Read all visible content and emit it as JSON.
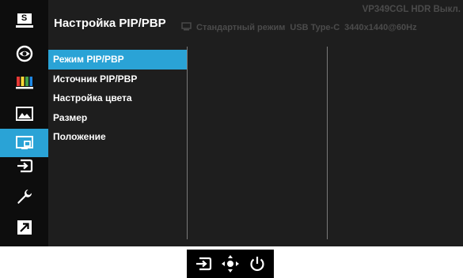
{
  "header": {
    "title": "Настройка PIP/PBP",
    "model": "VP349CGL HDR Выкл.",
    "status": {
      "mode": "Стандартный режим",
      "input": "USB Type-C",
      "resolution": "3440x1440@60Hz"
    }
  },
  "sidebar": {
    "items": [
      {
        "icon": "splendid-s-icon",
        "label": "S"
      },
      {
        "icon": "eye-care-icon"
      },
      {
        "icon": "color-bars-icon"
      },
      {
        "icon": "image-icon"
      },
      {
        "icon": "pip-pbp-icon",
        "active": true
      },
      {
        "icon": "input-select-icon"
      },
      {
        "icon": "wrench-icon"
      },
      {
        "icon": "shortcut-icon"
      }
    ]
  },
  "menu": {
    "items": [
      {
        "label": "Режим PIP/PBP",
        "active": true
      },
      {
        "label": "Источник PIP/PBP"
      },
      {
        "label": "Настройка цвета"
      },
      {
        "label": "Размер"
      },
      {
        "label": "Положение"
      }
    ]
  },
  "bottom_bar": {
    "buttons": [
      "input-select-icon",
      "navigation-joystick-icon",
      "power-icon"
    ]
  },
  "colors": {
    "accent": "#2aa3d6",
    "panel": "#1e1e1e",
    "sidebar": "#0d0d0d",
    "status_text": "#4b4b4b"
  }
}
